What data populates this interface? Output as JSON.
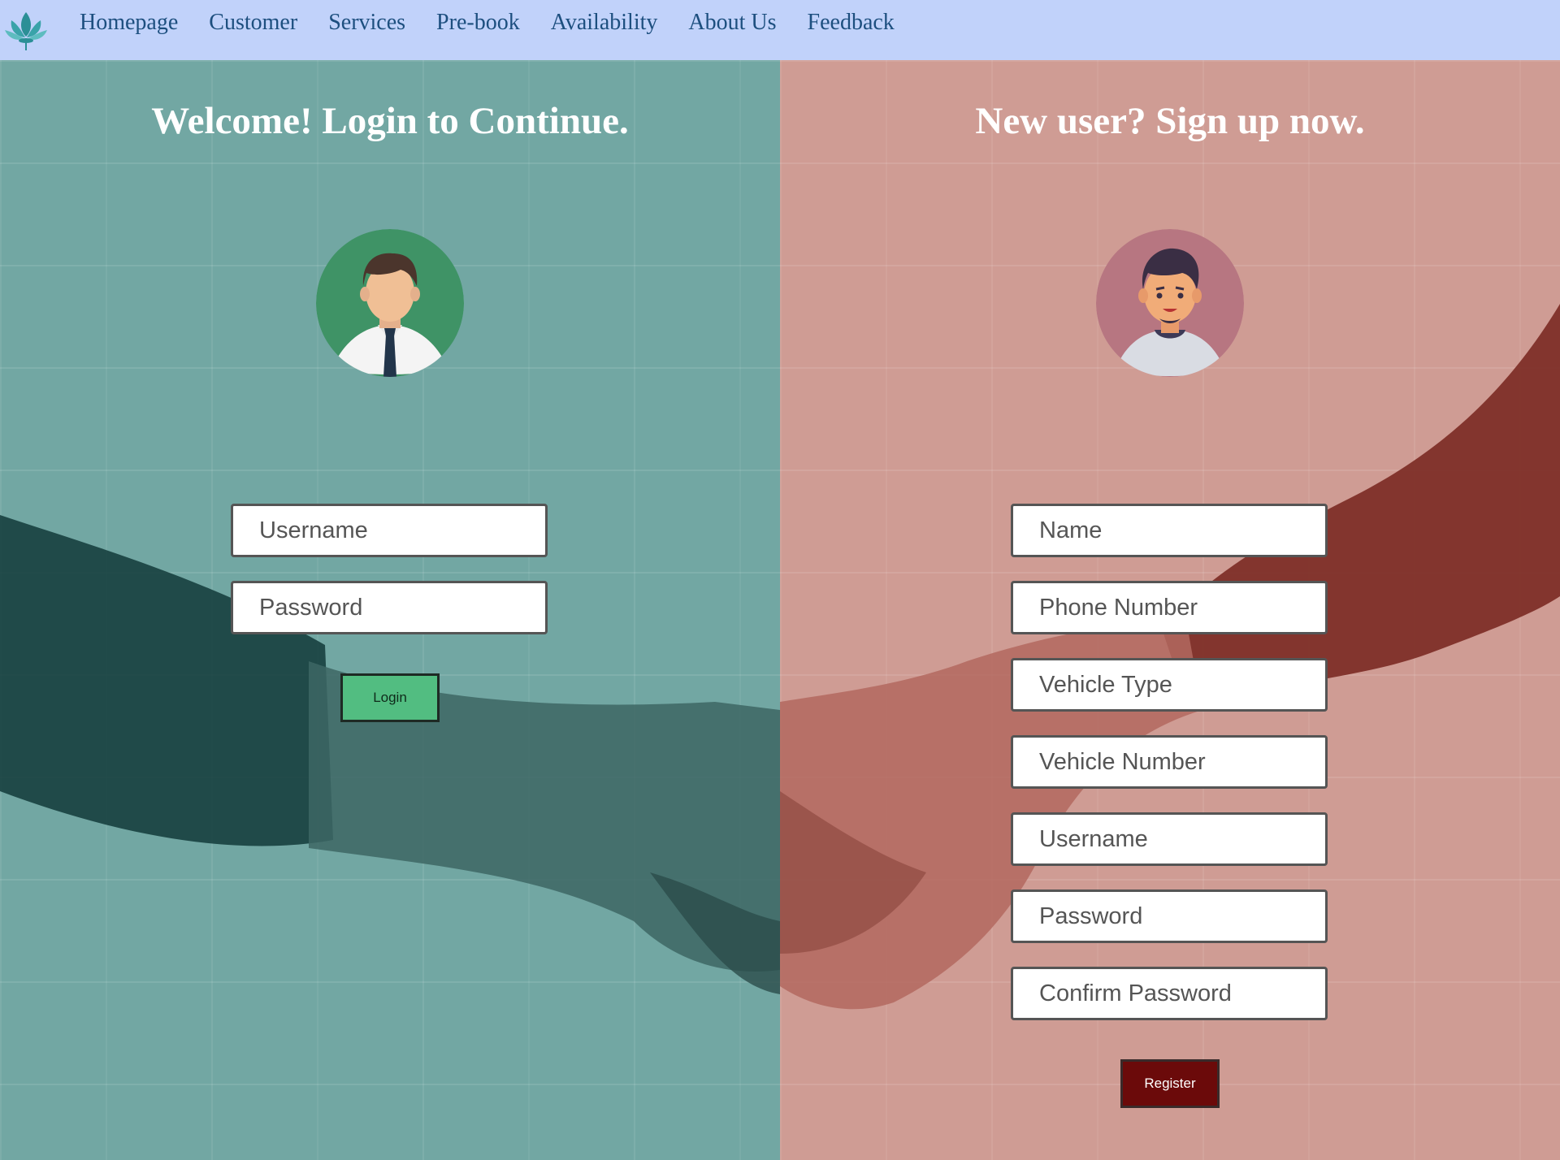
{
  "nav": {
    "logo_icon": "lotus-logo-icon",
    "items": [
      "Homepage",
      "Customer",
      "Services",
      "Pre-book",
      "Availability",
      "About Us",
      "Feedback"
    ]
  },
  "login": {
    "title": "Welcome! Login to Continue.",
    "avatar_icon": "businessman-avatar-icon",
    "fields": {
      "username_placeholder": "Username",
      "password_placeholder": "Password"
    },
    "button_label": "Login"
  },
  "signup": {
    "title": "New user? Sign up now.",
    "avatar_icon": "user-avatar-icon",
    "fields": {
      "name_placeholder": "Name",
      "phone_placeholder": "Phone Number",
      "vehicle_type_placeholder": "Vehicle Type",
      "vehicle_number_placeholder": "Vehicle Number",
      "username_placeholder": "Username",
      "password_placeholder": "Password",
      "confirm_password_placeholder": "Confirm Password"
    },
    "button_label": "Register"
  },
  "colors": {
    "navbar": "#c1d2fa",
    "nav_text": "#1d4f7f",
    "login_panel": "#72a7a3",
    "signup_panel": "#cf9c94",
    "login_button": "#52bd81",
    "register_button": "#6b0a0a"
  }
}
